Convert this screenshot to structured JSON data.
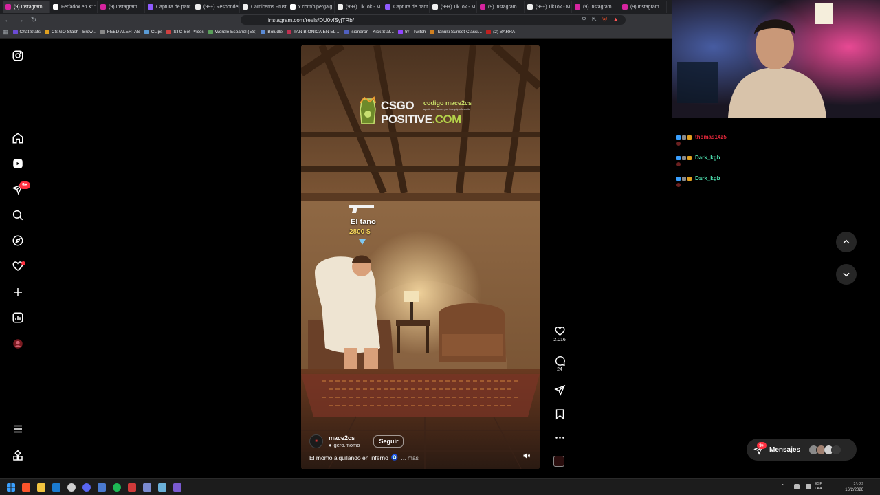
{
  "browser": {
    "tabs": [
      {
        "label": "(9) Instagram",
        "color": "#d6249f"
      },
      {
        "label": "Ferfadox en X: \"",
        "color": "#ffffff"
      },
      {
        "label": "(9) Instagram",
        "color": "#d6249f"
      },
      {
        "label": "Captura de pant",
        "color": "#8f5bff"
      },
      {
        "label": "(99+) Responder",
        "color": "#eeeeee"
      },
      {
        "label": "Carniceros Frust",
        "color": "#eeeeee"
      },
      {
        "label": "x.com/hipergalg",
        "color": "#ffffff"
      },
      {
        "label": "(99+) TikTok - M",
        "color": "#eeeeee"
      },
      {
        "label": "Captura de pant",
        "color": "#8f5bff"
      },
      {
        "label": "(99+) TikTok - M",
        "color": "#eeeeee"
      },
      {
        "label": "(9) Instagram",
        "color": "#d6249f"
      },
      {
        "label": "(99+) TikTok - M",
        "color": "#eeeeee"
      },
      {
        "label": "(9) Instagram",
        "color": "#d6249f"
      },
      {
        "label": "(9) Instagram",
        "color": "#d6249f"
      }
    ],
    "url": "instagram.com/reels/DU0vfSyjTRb/",
    "bookmarks": [
      {
        "label": "Chat Stats",
        "color": "#6b4bd6"
      },
      {
        "label": "CS.GO Stash - Brow...",
        "color": "#e0a020"
      },
      {
        "label": "FEED ALERTAS",
        "color": "#888888"
      },
      {
        "label": "CLips",
        "color": "#5a9bd5"
      },
      {
        "label": "STC Set Prices",
        "color": "#d04040"
      },
      {
        "label": "Wordle Español (ES)",
        "color": "#5aa05a"
      },
      {
        "label": "Boludle",
        "color": "#5a8ad5"
      },
      {
        "label": "TAN BIONICA EN EL ...",
        "color": "#c03050"
      },
      {
        "label": "sionaron - Kick Stat...",
        "color": "#5060c0"
      },
      {
        "label": "trr - Twitch",
        "color": "#9146ff"
      },
      {
        "label": "Tanuki Sunset Classi...",
        "color": "#d08020"
      },
      {
        "label": "(2) BARRA",
        "color": "#c02020"
      }
    ]
  },
  "instagram": {
    "nav": {
      "notifications_badge": "9+",
      "items": [
        "instagram-logo",
        "home",
        "reels",
        "messages",
        "search",
        "explore",
        "notifications",
        "create",
        "dashboard",
        "profile",
        "more",
        "also-from-meta"
      ]
    },
    "reel": {
      "sponsor_brand_main": "CSGO",
      "sponsor_brand_line2": "POSITIVE",
      "sponsor_brand_tld": ".COM",
      "sponsor_code": "codigo mace2cs",
      "sponsor_sub": "apoiá con bonos por tu equipo favorito",
      "overlay_name": "El tano",
      "overlay_price": "2800 $",
      "author": "mace2cs",
      "collaborator": "gero.momo",
      "follow_label": "Seguir",
      "caption": "El momo alquilando en inferno",
      "caption_emoji": "🧿",
      "caption_more": "... más"
    },
    "actions": {
      "likes": "2.016",
      "comments": "24"
    },
    "messages": {
      "label": "Mensajes",
      "badge": "9+"
    }
  },
  "stream_chat": [
    {
      "user": "thomas14z5",
      "color": "#e0283a"
    },
    {
      "user": "Dark_kgb",
      "color": "#4ee0b0"
    },
    {
      "user": "Dark_kgb",
      "color": "#4ee0b0"
    }
  ],
  "taskbar": {
    "lang_line1": "ESP",
    "lang_line2": "LAA",
    "time": "23:22",
    "date": "16/2/2026"
  }
}
